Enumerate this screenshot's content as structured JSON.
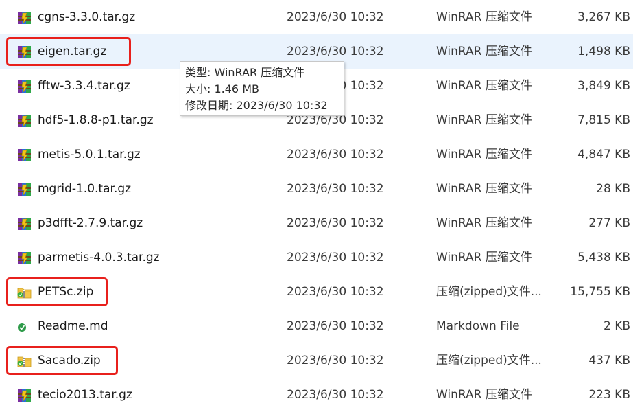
{
  "files": [
    {
      "name": "cgns-3.3.0.tar.gz",
      "date": "2023/6/30 10:32",
      "type": "WinRAR 压缩文件",
      "size": "3,267 KB",
      "icon": "winrar-archive-icon",
      "selected": false,
      "highlighted": false
    },
    {
      "name": "eigen.tar.gz",
      "date": "2023/6/30 10:32",
      "type": "WinRAR 压缩文件",
      "size": "1,498 KB",
      "icon": "winrar-archive-icon",
      "selected": true,
      "highlighted": true
    },
    {
      "name": "fftw-3.3.4.tar.gz",
      "date": "2023/6/30 10:32",
      "type": "WinRAR 压缩文件",
      "size": "3,849 KB",
      "icon": "winrar-archive-icon",
      "selected": false,
      "highlighted": false
    },
    {
      "name": "hdf5-1.8.8-p1.tar.gz",
      "date": "2023/6/30 10:32",
      "type": "WinRAR 压缩文件",
      "size": "7,815 KB",
      "icon": "winrar-archive-icon",
      "selected": false,
      "highlighted": false
    },
    {
      "name": "metis-5.0.1.tar.gz",
      "date": "2023/6/30 10:32",
      "type": "WinRAR 压缩文件",
      "size": "4,847 KB",
      "icon": "winrar-archive-icon",
      "selected": false,
      "highlighted": false
    },
    {
      "name": "mgrid-1.0.tar.gz",
      "date": "2023/6/30 10:32",
      "type": "WinRAR 压缩文件",
      "size": "28 KB",
      "icon": "winrar-archive-icon",
      "selected": false,
      "highlighted": false
    },
    {
      "name": "p3dfft-2.7.9.tar.gz",
      "date": "2023/6/30 10:32",
      "type": "WinRAR 压缩文件",
      "size": "277 KB",
      "icon": "winrar-archive-icon",
      "selected": false,
      "highlighted": false
    },
    {
      "name": "parmetis-4.0.3.tar.gz",
      "date": "2023/6/30 10:32",
      "type": "WinRAR 压缩文件",
      "size": "5,438 KB",
      "icon": "winrar-archive-icon",
      "selected": false,
      "highlighted": false
    },
    {
      "name": "PETSc.zip",
      "date": "2023/6/30 10:32",
      "type": "压缩(zipped)文件...",
      "size": "15,755 KB",
      "icon": "zip-folder-icon",
      "selected": false,
      "highlighted": true
    },
    {
      "name": "Readme.md",
      "date": "2023/6/30 10:32",
      "type": "Markdown File",
      "size": "2 KB",
      "icon": "markdown-file-icon",
      "selected": false,
      "highlighted": false
    },
    {
      "name": "Sacado.zip",
      "date": "2023/6/30 10:32",
      "type": "压缩(zipped)文件...",
      "size": "437 KB",
      "icon": "zip-folder-icon",
      "selected": false,
      "highlighted": true
    },
    {
      "name": "tecio2013.tar.gz",
      "date": "2023/6/30 10:32",
      "type": "WinRAR 压缩文件",
      "size": "223 KB",
      "icon": "winrar-archive-icon",
      "selected": false,
      "highlighted": false
    }
  ],
  "tooltip": {
    "type_line": "类型: WinRAR 压缩文件",
    "size_line": "大小: 1.46 MB",
    "modified_line": "修改日期: 2023/6/30 10:32"
  },
  "colors": {
    "selected_row": "#eaf3fd",
    "highlight_border": "#e8201c"
  }
}
